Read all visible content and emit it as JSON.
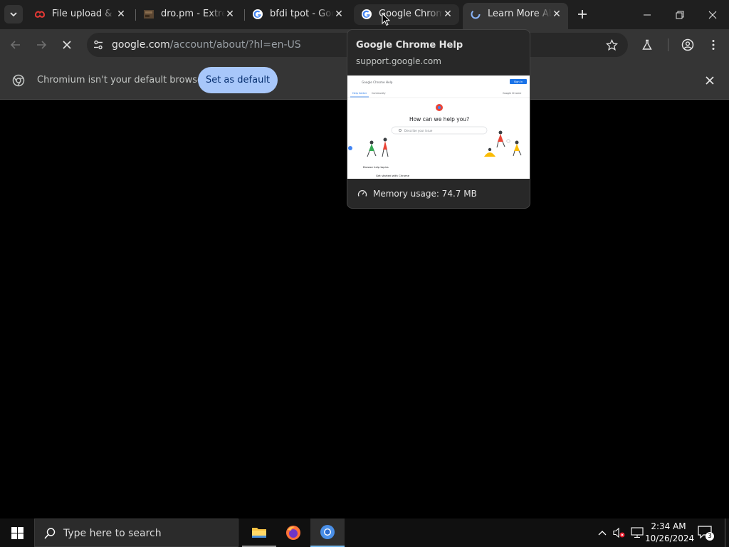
{
  "tabs": [
    {
      "title": "File upload & sharing",
      "icon": "file-share-icon"
    },
    {
      "title": "dro.pm - Extremely simple",
      "icon": "dropm-icon"
    },
    {
      "title": "bfdi tpot - Google Search",
      "icon": "google-icon"
    },
    {
      "title": "Google Chrome Help",
      "icon": "google-icon"
    },
    {
      "title": "Learn More About Google",
      "icon": "loading-icon"
    }
  ],
  "toolbar": {
    "url_host": "google.com",
    "url_path": "/account/about/?hl=en-US"
  },
  "infobar": {
    "message": "Chromium isn't your default browser",
    "button": "Set as default"
  },
  "hovercard": {
    "title": "Google Chrome Help",
    "domain": "support.google.com",
    "memory": "Memory usage: 74.7 MB",
    "preview": {
      "site_name": "Google Chrome Help",
      "sign_in": "Sign in",
      "tab_help": "Help Center",
      "tab_community": "Community",
      "topright_link": "Google Chrome",
      "heading": "How can we help you?",
      "search_placeholder": "Describe your issue",
      "section": "Browse help topics",
      "item": "Get started with Chrome"
    }
  },
  "taskbar": {
    "search_placeholder": "Type here to search",
    "time": "2:34 AM",
    "date": "10/26/2024",
    "notifications": "3"
  },
  "colors": {
    "tabstrip_bg": "#1f1f1f",
    "toolbar_bg": "#353535",
    "accent_button": "#a8c7fa",
    "page_bg": "#000000"
  }
}
